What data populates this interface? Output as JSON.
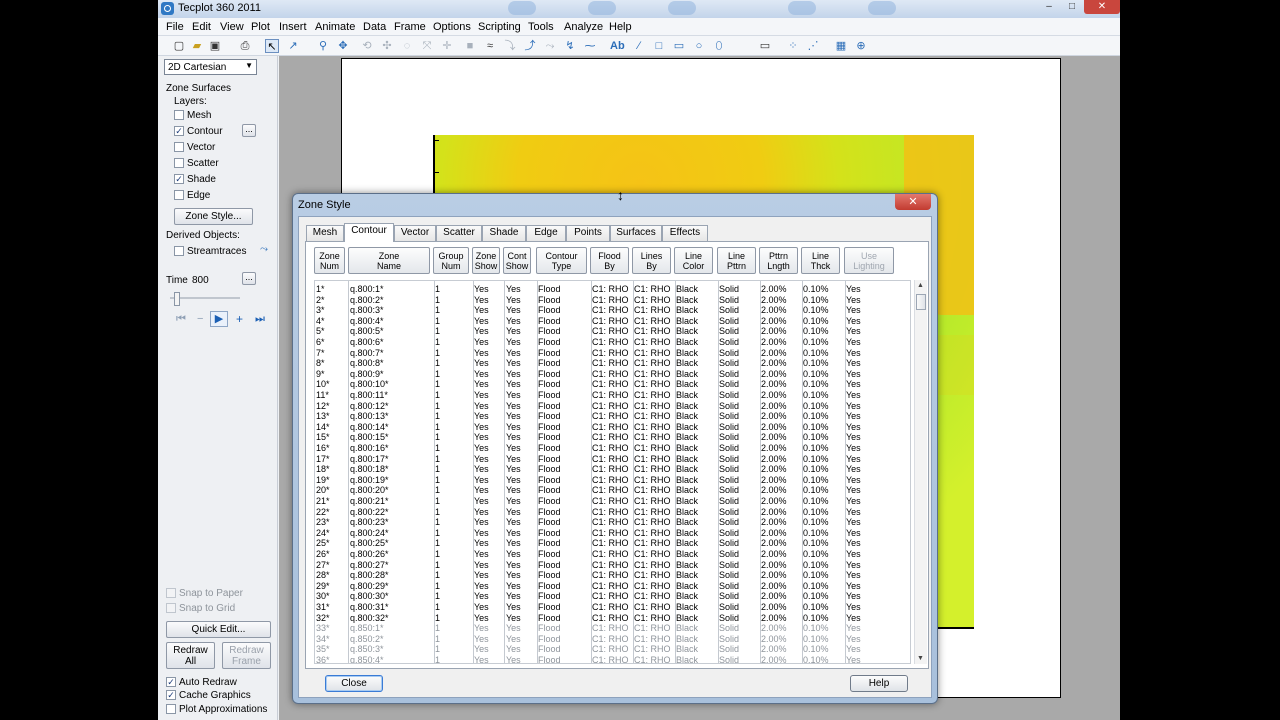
{
  "window": {
    "title": "Tecplot 360 2011",
    "minimize": "–",
    "maximize": "□",
    "close": "✕"
  },
  "menu": [
    "File",
    "Edit",
    "View",
    "Plot",
    "Insert",
    "Animate",
    "Data",
    "Frame",
    "Options",
    "Scripting",
    "Tools",
    "Analyze",
    "Help"
  ],
  "sidebar": {
    "plot_type": "2D Cartesian",
    "zone_surfaces": "Zone Surfaces",
    "layers_label": "Layers:",
    "layers": [
      {
        "label": "Mesh",
        "checked": false
      },
      {
        "label": "Contour",
        "checked": true
      },
      {
        "label": "Vector",
        "checked": false
      },
      {
        "label": "Scatter",
        "checked": false
      },
      {
        "label": "Shade",
        "checked": true
      },
      {
        "label": "Edge",
        "checked": false
      }
    ],
    "zone_style_button": "Zone Style...",
    "derived_objects": "Derived Objects:",
    "streamtraces": "Streamtraces",
    "time_label": "Time",
    "time_value": "800",
    "snap_to_paper": "Snap to Paper",
    "snap_to_grid": "Snap to Grid",
    "quick_edit": "Quick Edit...",
    "redraw_all": "Redraw All",
    "redraw_frame": "Redraw Frame",
    "auto_redraw": "Auto Redraw",
    "cache_graphics": "Cache Graphics",
    "plot_approximations": "Plot Approximations"
  },
  "dialog": {
    "title": "Zone Style",
    "tabs": [
      "Mesh",
      "Contour",
      "Vector",
      "Scatter",
      "Shade",
      "Edge",
      "Points",
      "Surfaces",
      "Effects"
    ],
    "active_tab": "Contour",
    "headers": [
      {
        "l1": "Zone",
        "l2": "Num"
      },
      {
        "l1": "Zone",
        "l2": "Name"
      },
      {
        "l1": "Group",
        "l2": "Num"
      },
      {
        "l1": "Zone",
        "l2": "Show"
      },
      {
        "l1": "Cont",
        "l2": "Show"
      },
      {
        "l1": "Contour",
        "l2": "Type"
      },
      {
        "l1": "Flood",
        "l2": "By"
      },
      {
        "l1": "Lines",
        "l2": "By"
      },
      {
        "l1": "Line",
        "l2": "Color"
      },
      {
        "l1": "Line",
        "l2": "Pttrn"
      },
      {
        "l1": "Pttrn",
        "l2": "Lngth"
      },
      {
        "l1": "Line",
        "l2": "Thck"
      },
      {
        "l1": "Use",
        "l2": "Lighting"
      }
    ],
    "rows": [
      [
        "1*",
        "q.800:1*",
        "1",
        "Yes",
        "Yes",
        "Flood",
        "C1: RHO",
        "C1: RHO",
        "Black",
        "Solid",
        "2.00%",
        "0.10%",
        "Yes"
      ],
      [
        "2*",
        "q.800:2*",
        "1",
        "Yes",
        "Yes",
        "Flood",
        "C1: RHO",
        "C1: RHO",
        "Black",
        "Solid",
        "2.00%",
        "0.10%",
        "Yes"
      ],
      [
        "3*",
        "q.800:3*",
        "1",
        "Yes",
        "Yes",
        "Flood",
        "C1: RHO",
        "C1: RHO",
        "Black",
        "Solid",
        "2.00%",
        "0.10%",
        "Yes"
      ],
      [
        "4*",
        "q.800:4*",
        "1",
        "Yes",
        "Yes",
        "Flood",
        "C1: RHO",
        "C1: RHO",
        "Black",
        "Solid",
        "2.00%",
        "0.10%",
        "Yes"
      ],
      [
        "5*",
        "q.800:5*",
        "1",
        "Yes",
        "Yes",
        "Flood",
        "C1: RHO",
        "C1: RHO",
        "Black",
        "Solid",
        "2.00%",
        "0.10%",
        "Yes"
      ],
      [
        "6*",
        "q.800:6*",
        "1",
        "Yes",
        "Yes",
        "Flood",
        "C1: RHO",
        "C1: RHO",
        "Black",
        "Solid",
        "2.00%",
        "0.10%",
        "Yes"
      ],
      [
        "7*",
        "q.800:7*",
        "1",
        "Yes",
        "Yes",
        "Flood",
        "C1: RHO",
        "C1: RHO",
        "Black",
        "Solid",
        "2.00%",
        "0.10%",
        "Yes"
      ],
      [
        "8*",
        "q.800:8*",
        "1",
        "Yes",
        "Yes",
        "Flood",
        "C1: RHO",
        "C1: RHO",
        "Black",
        "Solid",
        "2.00%",
        "0.10%",
        "Yes"
      ],
      [
        "9*",
        "q.800:9*",
        "1",
        "Yes",
        "Yes",
        "Flood",
        "C1: RHO",
        "C1: RHO",
        "Black",
        "Solid",
        "2.00%",
        "0.10%",
        "Yes"
      ],
      [
        "10*",
        "q.800:10*",
        "1",
        "Yes",
        "Yes",
        "Flood",
        "C1: RHO",
        "C1: RHO",
        "Black",
        "Solid",
        "2.00%",
        "0.10%",
        "Yes"
      ],
      [
        "11*",
        "q.800:11*",
        "1",
        "Yes",
        "Yes",
        "Flood",
        "C1: RHO",
        "C1: RHO",
        "Black",
        "Solid",
        "2.00%",
        "0.10%",
        "Yes"
      ],
      [
        "12*",
        "q.800:12*",
        "1",
        "Yes",
        "Yes",
        "Flood",
        "C1: RHO",
        "C1: RHO",
        "Black",
        "Solid",
        "2.00%",
        "0.10%",
        "Yes"
      ],
      [
        "13*",
        "q.800:13*",
        "1",
        "Yes",
        "Yes",
        "Flood",
        "C1: RHO",
        "C1: RHO",
        "Black",
        "Solid",
        "2.00%",
        "0.10%",
        "Yes"
      ],
      [
        "14*",
        "q.800:14*",
        "1",
        "Yes",
        "Yes",
        "Flood",
        "C1: RHO",
        "C1: RHO",
        "Black",
        "Solid",
        "2.00%",
        "0.10%",
        "Yes"
      ],
      [
        "15*",
        "q.800:15*",
        "1",
        "Yes",
        "Yes",
        "Flood",
        "C1: RHO",
        "C1: RHO",
        "Black",
        "Solid",
        "2.00%",
        "0.10%",
        "Yes"
      ],
      [
        "16*",
        "q.800:16*",
        "1",
        "Yes",
        "Yes",
        "Flood",
        "C1: RHO",
        "C1: RHO",
        "Black",
        "Solid",
        "2.00%",
        "0.10%",
        "Yes"
      ],
      [
        "17*",
        "q.800:17*",
        "1",
        "Yes",
        "Yes",
        "Flood",
        "C1: RHO",
        "C1: RHO",
        "Black",
        "Solid",
        "2.00%",
        "0.10%",
        "Yes"
      ],
      [
        "18*",
        "q.800:18*",
        "1",
        "Yes",
        "Yes",
        "Flood",
        "C1: RHO",
        "C1: RHO",
        "Black",
        "Solid",
        "2.00%",
        "0.10%",
        "Yes"
      ],
      [
        "19*",
        "q.800:19*",
        "1",
        "Yes",
        "Yes",
        "Flood",
        "C1: RHO",
        "C1: RHO",
        "Black",
        "Solid",
        "2.00%",
        "0.10%",
        "Yes"
      ],
      [
        "20*",
        "q.800:20*",
        "1",
        "Yes",
        "Yes",
        "Flood",
        "C1: RHO",
        "C1: RHO",
        "Black",
        "Solid",
        "2.00%",
        "0.10%",
        "Yes"
      ],
      [
        "21*",
        "q.800:21*",
        "1",
        "Yes",
        "Yes",
        "Flood",
        "C1: RHO",
        "C1: RHO",
        "Black",
        "Solid",
        "2.00%",
        "0.10%",
        "Yes"
      ],
      [
        "22*",
        "q.800:22*",
        "1",
        "Yes",
        "Yes",
        "Flood",
        "C1: RHO",
        "C1: RHO",
        "Black",
        "Solid",
        "2.00%",
        "0.10%",
        "Yes"
      ],
      [
        "23*",
        "q.800:23*",
        "1",
        "Yes",
        "Yes",
        "Flood",
        "C1: RHO",
        "C1: RHO",
        "Black",
        "Solid",
        "2.00%",
        "0.10%",
        "Yes"
      ],
      [
        "24*",
        "q.800:24*",
        "1",
        "Yes",
        "Yes",
        "Flood",
        "C1: RHO",
        "C1: RHO",
        "Black",
        "Solid",
        "2.00%",
        "0.10%",
        "Yes"
      ],
      [
        "25*",
        "q.800:25*",
        "1",
        "Yes",
        "Yes",
        "Flood",
        "C1: RHO",
        "C1: RHO",
        "Black",
        "Solid",
        "2.00%",
        "0.10%",
        "Yes"
      ],
      [
        "26*",
        "q.800:26*",
        "1",
        "Yes",
        "Yes",
        "Flood",
        "C1: RHO",
        "C1: RHO",
        "Black",
        "Solid",
        "2.00%",
        "0.10%",
        "Yes"
      ],
      [
        "27*",
        "q.800:27*",
        "1",
        "Yes",
        "Yes",
        "Flood",
        "C1: RHO",
        "C1: RHO",
        "Black",
        "Solid",
        "2.00%",
        "0.10%",
        "Yes"
      ],
      [
        "28*",
        "q.800:28*",
        "1",
        "Yes",
        "Yes",
        "Flood",
        "C1: RHO",
        "C1: RHO",
        "Black",
        "Solid",
        "2.00%",
        "0.10%",
        "Yes"
      ],
      [
        "29*",
        "q.800:29*",
        "1",
        "Yes",
        "Yes",
        "Flood",
        "C1: RHO",
        "C1: RHO",
        "Black",
        "Solid",
        "2.00%",
        "0.10%",
        "Yes"
      ],
      [
        "30*",
        "q.800:30*",
        "1",
        "Yes",
        "Yes",
        "Flood",
        "C1: RHO",
        "C1: RHO",
        "Black",
        "Solid",
        "2.00%",
        "0.10%",
        "Yes"
      ],
      [
        "31*",
        "q.800:31*",
        "1",
        "Yes",
        "Yes",
        "Flood",
        "C1: RHO",
        "C1: RHO",
        "Black",
        "Solid",
        "2.00%",
        "0.10%",
        "Yes"
      ],
      [
        "32*",
        "q.800:32*",
        "1",
        "Yes",
        "Yes",
        "Flood",
        "C1: RHO",
        "C1: RHO",
        "Black",
        "Solid",
        "2.00%",
        "0.10%",
        "Yes"
      ],
      [
        "33*",
        "q.850:1*",
        "1",
        "Yes",
        "Yes",
        "Flood",
        "C1: RHO",
        "C1: RHO",
        "Black",
        "Solid",
        "2.00%",
        "0.10%",
        "Yes"
      ],
      [
        "34*",
        "q.850:2*",
        "1",
        "Yes",
        "Yes",
        "Flood",
        "C1: RHO",
        "C1: RHO",
        "Black",
        "Solid",
        "2.00%",
        "0.10%",
        "Yes"
      ],
      [
        "35*",
        "q.850:3*",
        "1",
        "Yes",
        "Yes",
        "Flood",
        "C1: RHO",
        "C1: RHO",
        "Black",
        "Solid",
        "2.00%",
        "0.10%",
        "Yes"
      ],
      [
        "36*",
        "q.850:4*",
        "1",
        "Yes",
        "Yes",
        "Flood",
        "C1: RHO",
        "C1: RHO",
        "Black",
        "Solid",
        "2.00%",
        "0.10%",
        "Yes"
      ]
    ],
    "inactive_from_row": 33,
    "close_button": "Close",
    "help_button": "Help"
  },
  "colors": {
    "accent": "#2f78c4",
    "contour_yellow": "#f5c316",
    "contour_green": "#b9ea2a"
  }
}
